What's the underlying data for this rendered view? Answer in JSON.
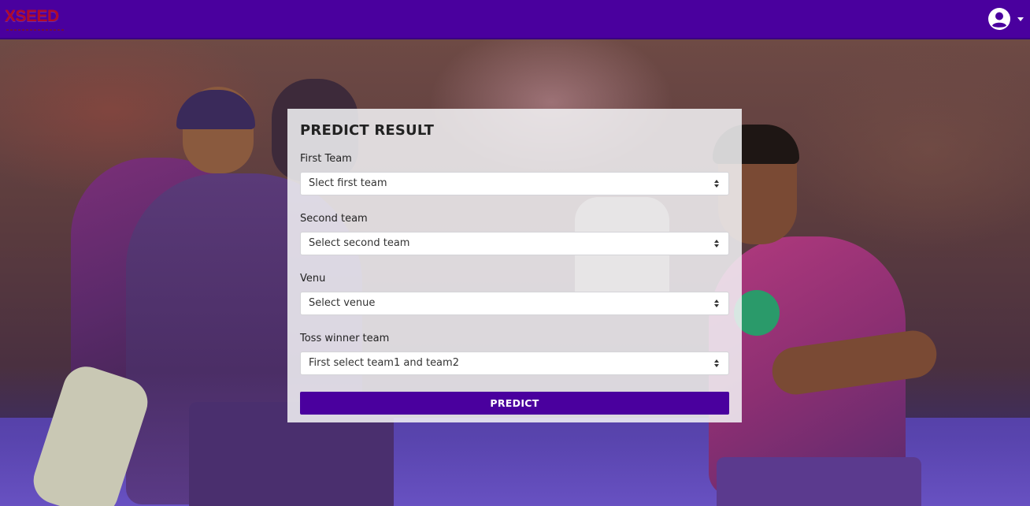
{
  "navbar": {
    "brand": "XSEED",
    "account_icon": "account-circle-icon",
    "caret_icon": "caret-down-icon"
  },
  "colors": {
    "primary": "#4a009e",
    "brand_red": "#b00a2a",
    "panel_bg": "#f3f3f6"
  },
  "form": {
    "title": "PREDICT RESULT",
    "fields": [
      {
        "label": "First Team",
        "selected": "Slect first team"
      },
      {
        "label": "Second team",
        "selected": "Select second team"
      },
      {
        "label": "Venu",
        "selected": "Select venue"
      },
      {
        "label": "Toss winner team",
        "selected": "First select team1 and team2"
      }
    ],
    "submit_label": "PREDICT"
  }
}
